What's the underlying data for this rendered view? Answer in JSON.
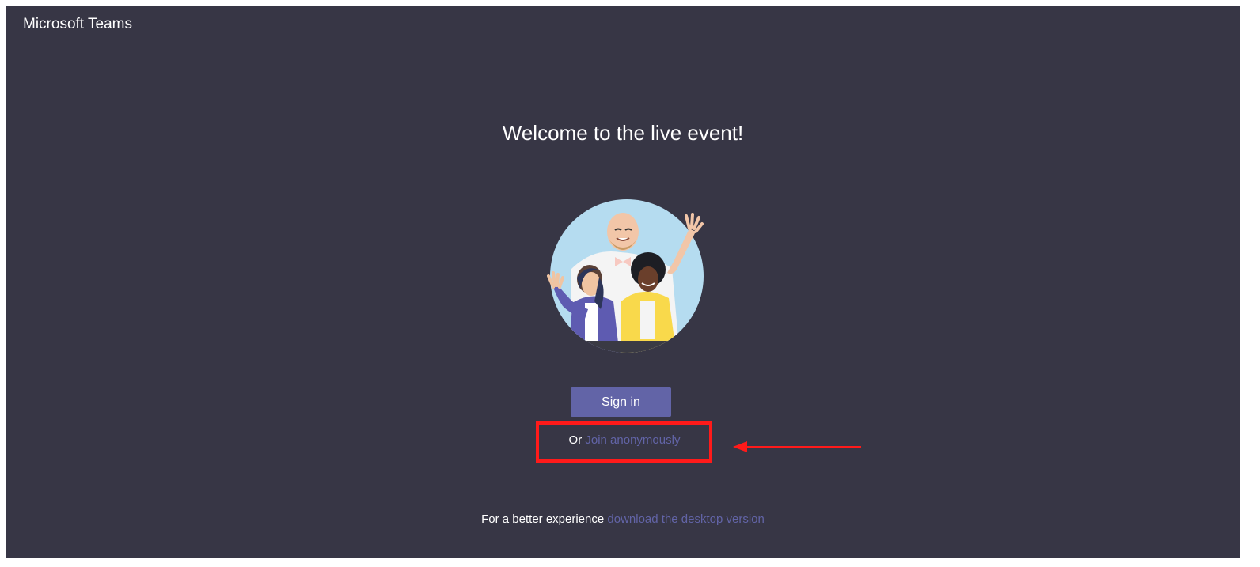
{
  "app": {
    "title": "Microsoft Teams"
  },
  "main": {
    "heading": "Welcome to the live event!",
    "illustration_icon": "people-waving-illustration",
    "sign_in_label": "Sign in",
    "or_text": "Or",
    "join_link": "Join anonymously"
  },
  "footer": {
    "text": "For a better experience",
    "link": "download the desktop version"
  },
  "colors": {
    "background": "#373645",
    "accent": "#6264a7",
    "annotation": "#ff1a1a"
  }
}
